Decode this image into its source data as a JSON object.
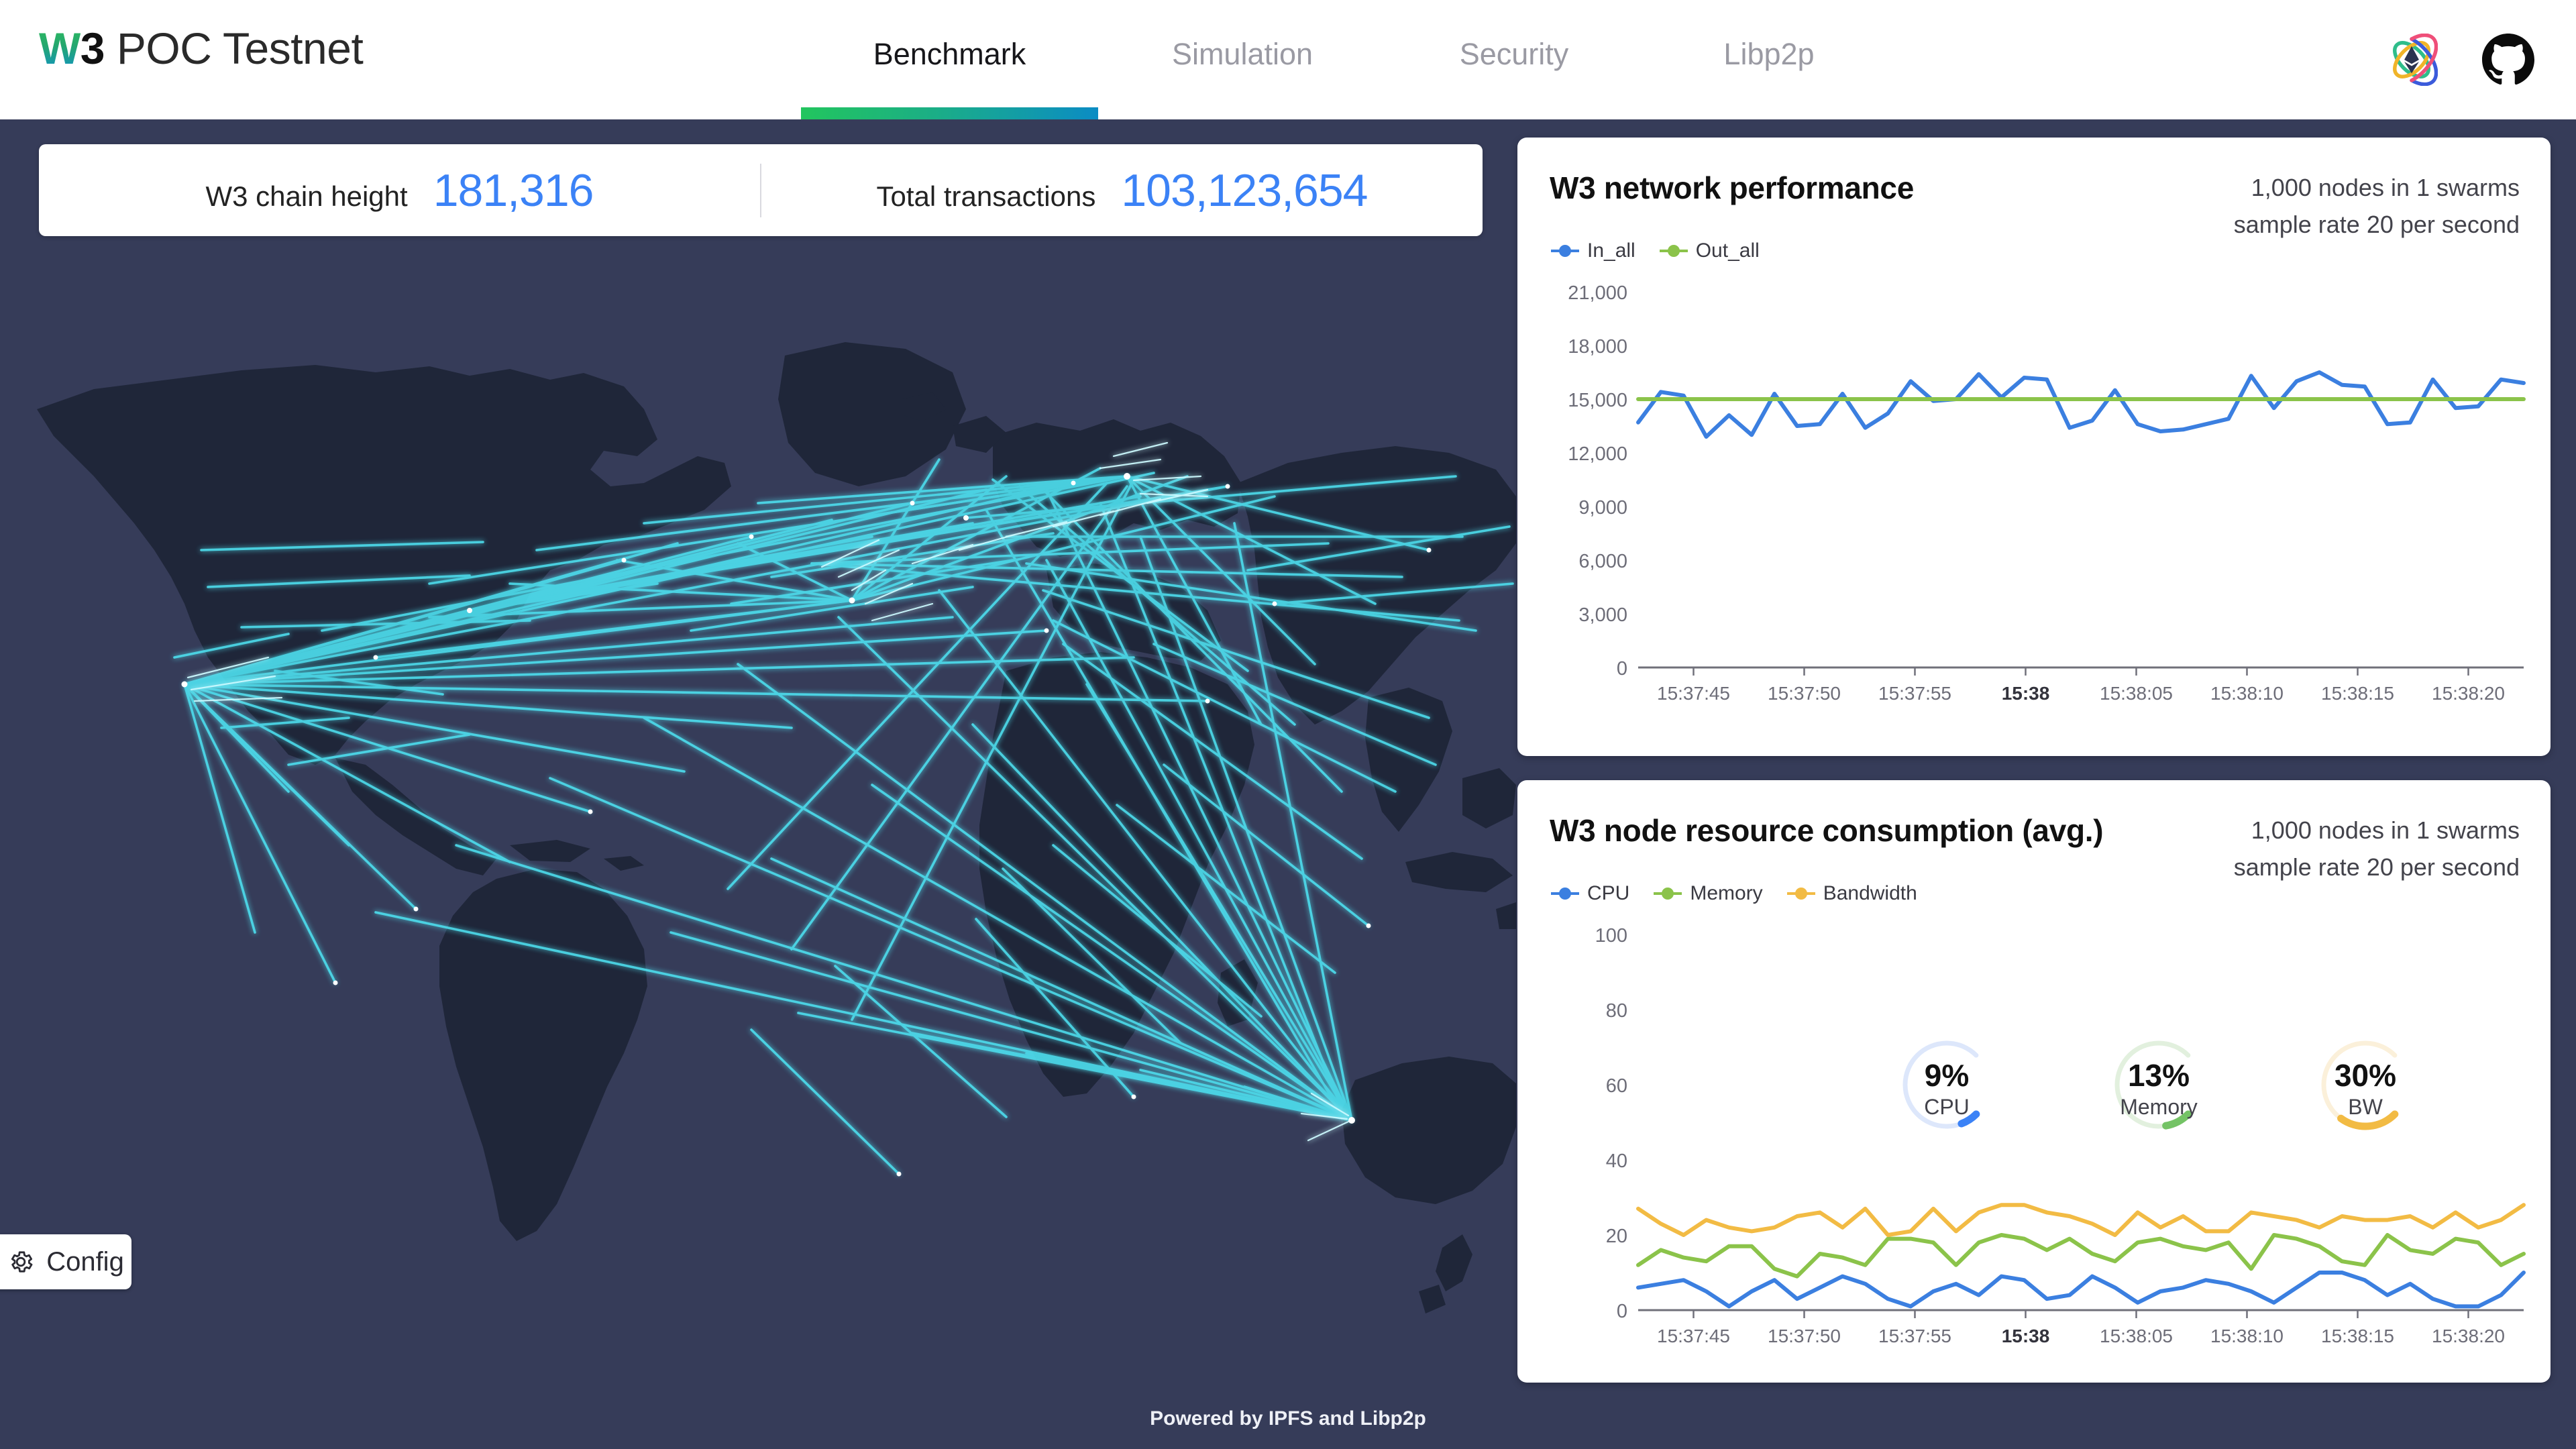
{
  "brand": {
    "w": "W",
    "three": "3",
    "rest": " POC Testnet"
  },
  "nav": {
    "tabs": [
      {
        "id": "benchmark",
        "label": "Benchmark",
        "active": true
      },
      {
        "id": "simulation",
        "label": "Simulation",
        "active": false
      },
      {
        "id": "security",
        "label": "Security",
        "active": false
      },
      {
        "id": "libp2p",
        "label": "Libp2p",
        "active": false
      }
    ],
    "icons": [
      {
        "name": "ethereum-atom-icon",
        "title": "Ethereum"
      },
      {
        "name": "github-icon",
        "title": "GitHub"
      }
    ],
    "active_underline_gradient": [
      "#22c55e",
      "#0b8cc4"
    ]
  },
  "stats": {
    "items": [
      {
        "label": "W3 chain height",
        "value": "181,316"
      },
      {
        "label": "Total transactions",
        "value": "103,123,654"
      }
    ],
    "value_color": "#3b82f6"
  },
  "map": {
    "name": "world-connection-map",
    "ocean_color": "#363c59",
    "land_color": "#1f2639",
    "arc_color": "#4fe6f5",
    "node_color": "#ffffff"
  },
  "config_button": {
    "label": "Config",
    "icon": "gear-icon"
  },
  "footer": {
    "text": "Powered by IPFS and Libp2p"
  },
  "cards": [
    {
      "id": "perf",
      "title": "W3 network performance",
      "meta_line1": "1,000 nodes in 1 swarms",
      "meta_line2": "sample rate 20 per second"
    },
    {
      "id": "resource",
      "title": "W3 node resource consumption (avg.)",
      "meta_line1": "1,000 nodes in 1 swarms",
      "meta_line2": "sample rate 20 per second"
    }
  ],
  "gauges": [
    {
      "name": "cpu-gauge",
      "value": 9,
      "value_label": "9%",
      "caption": "CPU",
      "color": "#3b82f6",
      "track": "#dde7fb"
    },
    {
      "name": "memory-gauge",
      "value": 13,
      "value_label": "13%",
      "caption": "Memory",
      "color": "#74c365",
      "track": "#e2f0de"
    },
    {
      "name": "bandwidth-gauge",
      "value": 30,
      "value_label": "30%",
      "caption": "BW",
      "color": "#f2bb44",
      "track": "#fbf0da"
    }
  ],
  "chart_data": [
    {
      "id": "network-performance",
      "type": "line",
      "title": "W3 network performance",
      "xlabel": "",
      "ylabel": "",
      "ylim": [
        0,
        21000
      ],
      "yticks": [
        0,
        3000,
        6000,
        9000,
        12000,
        15000,
        18000,
        21000
      ],
      "yticklabels": [
        "0",
        "3,000",
        "6,000",
        "9,000",
        "12,000",
        "15,000",
        "18,000",
        "21,000"
      ],
      "xticklabels": [
        "15:37:45",
        "15:37:50",
        "15:37:55",
        "15:38",
        "15:38:05",
        "15:38:10",
        "15:38:15",
        "15:38:20"
      ],
      "xtick_bold_index": 3,
      "grid": false,
      "legend_position": "top-left",
      "series": [
        {
          "name": "In_all",
          "color": "#3b7fe0",
          "values": [
            13700,
            15400,
            15200,
            12900,
            14100,
            13000,
            15300,
            13500,
            13600,
            15300,
            13400,
            14200,
            16000,
            14900,
            15000,
            16400,
            15100,
            16200,
            16100,
            13400,
            13800,
            15500,
            13600,
            13200,
            13300,
            13600,
            13900,
            16300,
            14500,
            16000,
            16500,
            15800,
            15700,
            13600,
            13700,
            16100,
            14500,
            14600,
            16100,
            15900
          ]
        },
        {
          "name": "Out_all",
          "color": "#8bc34a",
          "values": [
            15000,
            15000,
            15000,
            15000,
            15000,
            15000,
            15000,
            15000,
            15000,
            15000,
            15000,
            15000,
            15000,
            15000,
            15000,
            15000,
            15000,
            15000,
            15000,
            15000,
            15000,
            15000,
            15000,
            15000,
            15000,
            15000,
            15000,
            15000,
            15000,
            15000,
            15000,
            15000,
            15000,
            15000,
            15000,
            15000,
            15000,
            15000,
            15000,
            15000
          ]
        }
      ]
    },
    {
      "id": "node-resource-consumption",
      "type": "line",
      "title": "W3 node resource consumption (avg.)",
      "xlabel": "",
      "ylabel": "",
      "ylim": [
        0,
        100
      ],
      "yticks": [
        0,
        20,
        40,
        60,
        80,
        100
      ],
      "yticklabels": [
        "0",
        "20",
        "40",
        "60",
        "80",
        "100"
      ],
      "xticklabels": [
        "15:37:45",
        "15:37:50",
        "15:37:55",
        "15:38",
        "15:38:05",
        "15:38:10",
        "15:38:15",
        "15:38:20"
      ],
      "xtick_bold_index": 3,
      "grid": false,
      "legend_position": "top-left",
      "series": [
        {
          "name": "CPU",
          "color": "#3b7fe0",
          "values": [
            6,
            7,
            8,
            5,
            1,
            5,
            8,
            3,
            6,
            9,
            7,
            3,
            1,
            5,
            7,
            4,
            9,
            8,
            3,
            4,
            9,
            6,
            2,
            5,
            6,
            8,
            7,
            5,
            2,
            6,
            10,
            10,
            8,
            4,
            7,
            3,
            1,
            1,
            4,
            10
          ]
        },
        {
          "name": "Memory",
          "color": "#8bc34a",
          "values": [
            12,
            16,
            14,
            13,
            17,
            17,
            11,
            9,
            15,
            14,
            12,
            19,
            19,
            18,
            12,
            18,
            20,
            19,
            16,
            19,
            15,
            13,
            18,
            19,
            17,
            16,
            18,
            11,
            20,
            19,
            17,
            13,
            12,
            20,
            16,
            15,
            19,
            18,
            12,
            15
          ]
        },
        {
          "name": "Bandwidth",
          "color": "#f2bb44",
          "values": [
            27,
            23,
            20,
            24,
            22,
            21,
            22,
            25,
            26,
            22,
            27,
            20,
            21,
            27,
            21,
            26,
            28,
            28,
            26,
            25,
            23,
            20,
            26,
            22,
            25,
            21,
            21,
            26,
            25,
            24,
            22,
            25,
            24,
            24,
            25,
            22,
            26,
            22,
            24,
            28
          ]
        }
      ]
    }
  ]
}
